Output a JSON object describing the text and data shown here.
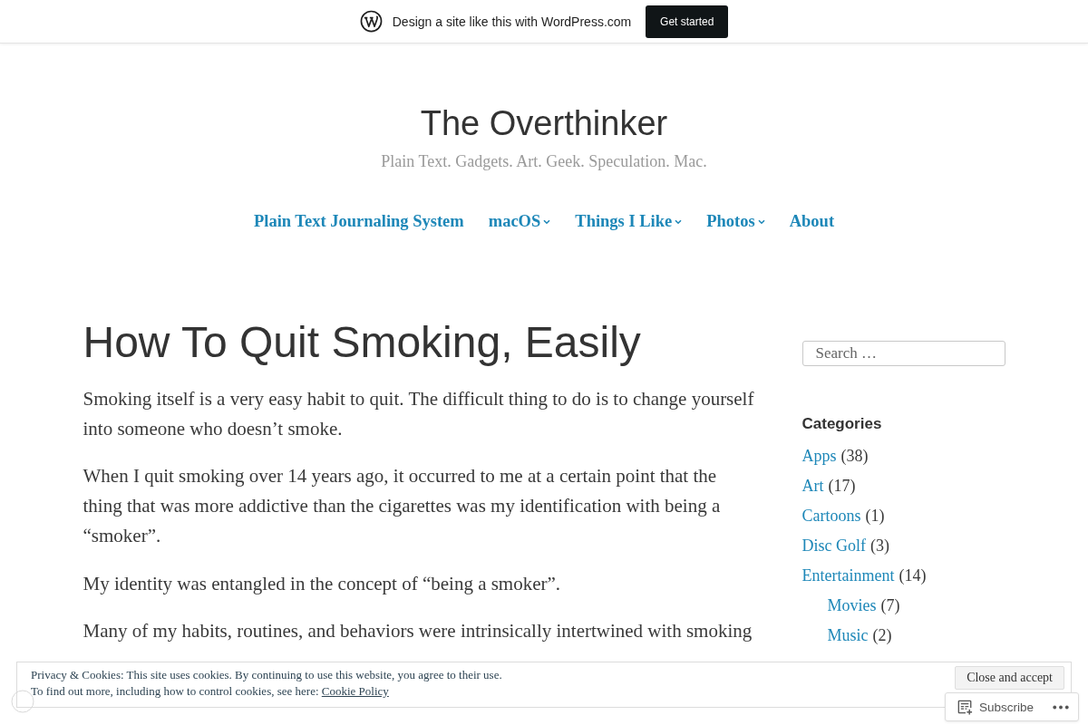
{
  "promo_bar": {
    "text": "Design a site like this with WordPress.com",
    "button": "Get started"
  },
  "site": {
    "title": "The Overthinker",
    "tagline": "Plain Text. Gadgets. Art. Geek. Speculation. Mac."
  },
  "nav": [
    {
      "label": "Plain Text Journaling System",
      "submenu": false
    },
    {
      "label": "macOS",
      "submenu": true
    },
    {
      "label": "Things I Like",
      "submenu": true
    },
    {
      "label": "Photos",
      "submenu": true
    },
    {
      "label": "About",
      "submenu": false
    }
  ],
  "article": {
    "title": "How To Quit Smoking, Easily",
    "paragraphs": [
      "Smoking itself is a very easy habit to quit. The difficult thing to do is to change yourself into someone who doesn’t smoke.",
      "When I quit smoking over 14 years ago, it occurred to me at a certain point that the thing that was more addictive than the cigarettes was my identification with being a “smoker”.",
      "My identity was entangled in the concept of “being a smoker”.",
      "Many of my habits, routines, and behaviors were intrinsically intertwined with smoking"
    ]
  },
  "sidebar": {
    "search": {
      "placeholder": "Search …"
    },
    "categories": {
      "title": "Categories",
      "items": [
        {
          "name": "Apps",
          "count": "(38)"
        },
        {
          "name": "Art",
          "count": "(17)"
        },
        {
          "name": "Cartoons",
          "count": "(1)"
        },
        {
          "name": "Disc Golf",
          "count": "(3)"
        },
        {
          "name": "Entertainment",
          "count": "(14)",
          "children": [
            {
              "name": "Movies",
              "count": "(7)"
            },
            {
              "name": "Music",
              "count": "(2)"
            }
          ]
        }
      ]
    }
  },
  "cookie_notice": {
    "text": "Privacy & Cookies: This site uses cookies. By continuing to use this website, you agree to their use.",
    "policy_text": "To find out more, including how to control cookies, see here:",
    "policy_link": "Cookie Policy",
    "button": "Close and accept"
  },
  "subscribe_bar": {
    "label": "Subscribe"
  }
}
